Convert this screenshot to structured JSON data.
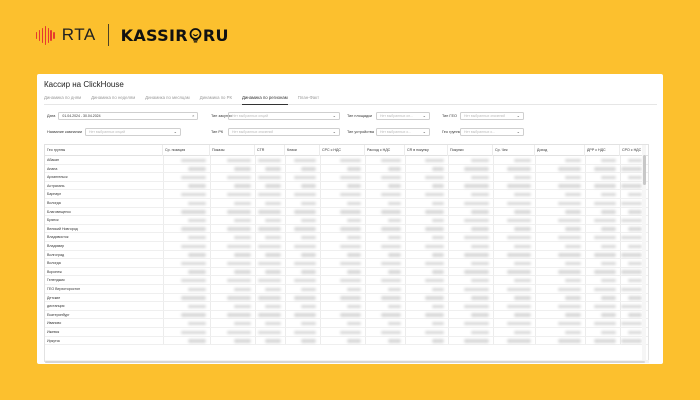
{
  "brand": {
    "rta_label": "RTA",
    "kassir_label": "KASSIR",
    "kassir_suffix": "RU",
    "rta_color": "#E63A2E",
    "background_color": "#FCC02E"
  },
  "app": {
    "title": "Кассир на ClickHouse",
    "tabs": [
      {
        "label": "Динамика по дням"
      },
      {
        "label": "Динамика по неделям"
      },
      {
        "label": "Динамика по месяцам"
      },
      {
        "label": "Динамика по РК"
      },
      {
        "label": "Динамика по регионам"
      },
      {
        "label": "План-Факт"
      }
    ],
    "active_tab": "Динамика по регионам"
  },
  "filters": {
    "date": {
      "label": "Дата",
      "value": "01.04.2024 - 30.04.2024"
    },
    "campaign_name": {
      "label": "Название кампании",
      "placeholder": "Нет выбранных опций"
    },
    "auction_type": {
      "label": "Тип закупки",
      "placeholder": "Нет выбранных опций"
    },
    "rk_type": {
      "label": "Тип РК",
      "placeholder": "Нет выбранных значений"
    },
    "placement_type": {
      "label": "Тип площадки",
      "placeholder": "Нет выбранных оп..."
    },
    "device_type": {
      "label": "Тип устройства",
      "placeholder": "Нет выбранных о..."
    },
    "geo_type": {
      "label": "Тип ГЕО",
      "placeholder": "Нет выбранных значений"
    },
    "geo_groups": {
      "label": "Гео группы",
      "placeholder": "Нет выбранных о..."
    }
  },
  "table": {
    "columns": [
      "Гео группы",
      "Ср. позиция",
      "Показы",
      "CTR",
      "Клики",
      "CPC с НДС",
      "Расход с НДС",
      "CR в покупку",
      "Покупки",
      "Ср. Чек",
      "Доход",
      "ДРР с НДС",
      "CPO с НДС"
    ],
    "rows": [
      "Абакан",
      "Анапа",
      "Архангельск",
      "Астрахань",
      "Барнаул",
      "Вологда",
      "Благовещенск",
      "Брянск",
      "Великий Новгород",
      "Владивосток",
      "Владимир",
      "Волгоград",
      "Вологда",
      "Воронеж",
      "Геленджик",
      "ГЕО Верхоторостон",
      "Детские",
      "дистанция",
      "Екатеринбург",
      "Иваново",
      "Ижевск",
      "Иркутск"
    ]
  }
}
